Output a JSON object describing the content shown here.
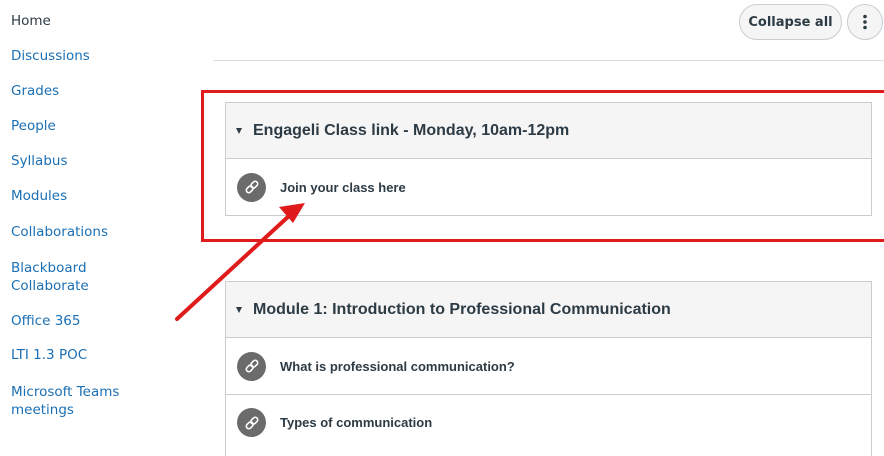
{
  "sidebar": {
    "items": [
      {
        "label": "Home",
        "current": true
      },
      {
        "label": "Discussions"
      },
      {
        "label": "Grades"
      },
      {
        "label": "People"
      },
      {
        "label": "Syllabus"
      },
      {
        "label": "Modules"
      },
      {
        "label": "Collaborations"
      },
      {
        "label": "Blackboard Collaborate"
      },
      {
        "label": "Office 365"
      },
      {
        "label": "LTI 1.3 POC"
      },
      {
        "label": "Microsoft Teams meetings"
      }
    ]
  },
  "header": {
    "collapse_label": "Collapse all",
    "more_icon": "vertical-ellipsis-icon"
  },
  "modules": [
    {
      "title": "Engageli Class link - Monday, 10am-12pm",
      "items": [
        {
          "title": "Join your class here",
          "icon": "link-icon"
        }
      ]
    },
    {
      "title": "Module 1: Introduction to Professional Communication",
      "items": [
        {
          "title": "What is professional communication?",
          "icon": "link-icon"
        },
        {
          "title": "Types of communication",
          "icon": "link-icon"
        }
      ]
    }
  ],
  "colors": {
    "link": "#1b6fb4",
    "text": "#2d3b45",
    "annotation": "#e01b1b",
    "icon_bg": "#6b6b6b"
  }
}
